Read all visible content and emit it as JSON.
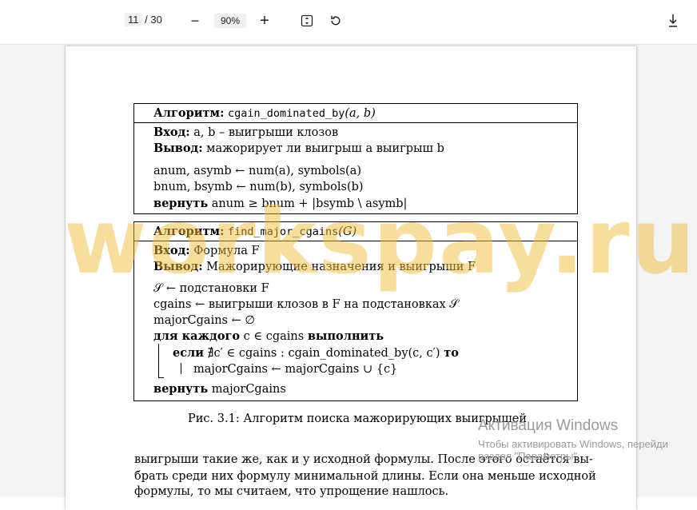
{
  "toolbar": {
    "page_current": "11",
    "page_total": "/ 30",
    "zoom": "90%",
    "zoom_out_glyph": "−",
    "zoom_in_glyph": "+",
    "fit_icon": "fit-page-icon",
    "rotate_icon": "rotate-icon",
    "download_icon": "download-icon"
  },
  "algo1": {
    "title_kw": "Алгоритм:",
    "title_name": "cgain_dominated_by",
    "title_args": "(a, b)",
    "input_kw": "Вход:",
    "input_text": " a, b – выигрыши клозов",
    "output_kw": "Вывод:",
    "output_text": " мажорирует ли выигрыш a выигрыш b",
    "line1": "anum, asymb ← num(a), symbols(a)",
    "line2": "bnum, bsymb ← num(b), symbols(b)",
    "line3_kw": "вернуть",
    "line3_text": " anum ≥ bnum + |bsymb \\ asymb|"
  },
  "algo2": {
    "title_kw": "Алгоритм:",
    "title_name": "find_major_cgains",
    "title_args": "(G)",
    "input_kw": "Вход:",
    "input_text": " Формула F",
    "output_kw": "Вывод:",
    "output_text": " Мажорирующие назначения и выигрыши F",
    "line1": "𝒮 ← подстановки F",
    "line2": "cgains ← выигрыши клозов в F на подстановках 𝒮",
    "line3": "majorCgains ← ∅",
    "loop_kw": "для каждого",
    "loop_text": " c ∈ cgains ",
    "loop_kw2": "выполнить",
    "if_kw": "если",
    "if_text": "  ∄c′ ∈ cgains : cgain_dominated_by(c, c′) ",
    "if_kw2": "то",
    "then_text": "majorCgains ← majorCgains ∪ {c}",
    "ret_kw": "вернуть",
    "ret_text": " majorCgains"
  },
  "caption": "Рис. 3.1: Алгоритм поиска мажорирующих выигрышей",
  "paragraph": [
    "выигрыши такие же, как и у исходной формулы. После этого остаётся вы-",
    "брать среди них формулу минимальной длины. Если она меньше исходной",
    "формулы, то мы считаем, что упрощение нашлось."
  ],
  "watermark": "workspay.ru",
  "activation": {
    "title": "Активация Windows",
    "line1": "Чтобы активировать Windows, перейди",
    "line2": "раздел \"Параметры\"."
  }
}
